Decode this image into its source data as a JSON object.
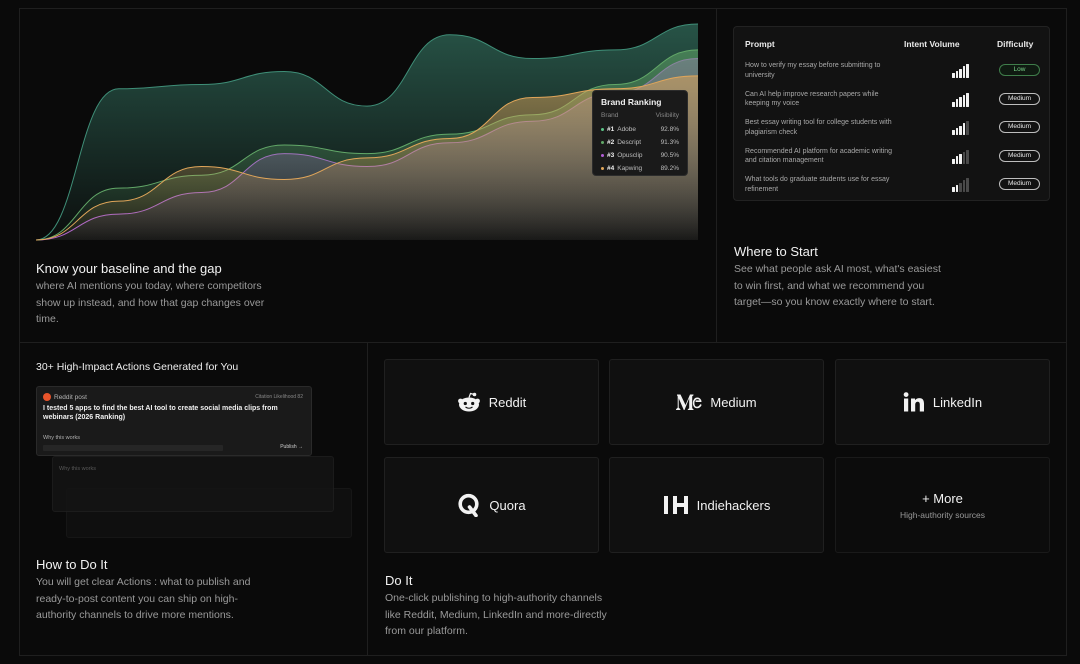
{
  "chart_data": {
    "type": "area",
    "tooltip": {
      "title": "Brand Ranking",
      "col_brand": "Brand",
      "col_visibility": "Visibility",
      "rows": [
        {
          "rank": "#1",
          "brand": "Adobe",
          "value": "92.8%",
          "color": "#5cc487"
        },
        {
          "rank": "#2",
          "brand": "Descript",
          "value": "91.3%",
          "color": "#62a868"
        },
        {
          "rank": "#3",
          "brand": "Opusclip",
          "value": "90.5%",
          "color": "#b35ed8"
        },
        {
          "rank": "#4",
          "brand": "Kapwing",
          "value": "89.2%",
          "color": "#e1a65a"
        }
      ]
    },
    "series": [
      {
        "color": "#3f8f78",
        "values": [
          0,
          70,
          72,
          78,
          62,
          95,
          84,
          88,
          100
        ]
      },
      {
        "color": "#b35ed8",
        "values": [
          0,
          12,
          22,
          40,
          34,
          45,
          55,
          68,
          84
        ]
      },
      {
        "color": "#62a868",
        "values": [
          0,
          24,
          30,
          44,
          40,
          49,
          58,
          72,
          88
        ]
      },
      {
        "color": "#e1a65a",
        "values": [
          0,
          18,
          34,
          28,
          38,
          47,
          66,
          70,
          76
        ]
      }
    ]
  },
  "baseline": {
    "title": "Know your baseline and the gap",
    "desc": "where AI mentions you today, where competitors show up instead, and how that gap changes over time."
  },
  "prompts": {
    "head_prompt": "Prompt",
    "head_volume": "Intent Volume",
    "head_difficulty": "Difficulty",
    "rows": [
      {
        "text": "How to verify my essay before submitting to university",
        "bars": 5,
        "difficulty": "Low"
      },
      {
        "text": "Can AI help improve research papers while keeping my voice",
        "bars": 5,
        "difficulty": "Medium"
      },
      {
        "text": "Best essay writing tool for college students with plagiarism check",
        "bars": 4,
        "difficulty": "Medium"
      },
      {
        "text": "Recommended AI platform for academic writing and citation management",
        "bars": 3,
        "difficulty": "Medium"
      },
      {
        "text": "What tools do graduate students use for essay refinement",
        "bars": 2,
        "difficulty": "Medium"
      }
    ]
  },
  "start": {
    "title": "Where to Start",
    "desc": "See what people ask AI most, what's easiest to win first, and what we recommend you target—so you know exactly where to start."
  },
  "actions": {
    "heading": "30+ High-Impact Actions Generated for You",
    "card_source": "Reddit post",
    "card_meta": "Citation Likelihood 82",
    "card_title": "I tested 5 apps to find the best AI tool to create social media clips from webinars (2026 Ranking)",
    "card_why": "Why this works",
    "card_publish": "Publish  →",
    "ghost_why": "Why this works",
    "title": "How to Do It",
    "desc": "You will get clear Actions : what to publish and ready-to-post content you can ship on high-authority channels to drive more mentions."
  },
  "platforms": {
    "items": [
      {
        "name": "Reddit"
      },
      {
        "name": "Medium"
      },
      {
        "name": "LinkedIn"
      },
      {
        "name": "Quora"
      },
      {
        "name": "Indiehackers"
      }
    ],
    "more_label": "+ More",
    "more_sub": "High-authority sources",
    "title": "Do It",
    "desc": "One-click publishing to high-authority channels like Reddit, Medium, LinkedIn and more-directly from our platform."
  }
}
